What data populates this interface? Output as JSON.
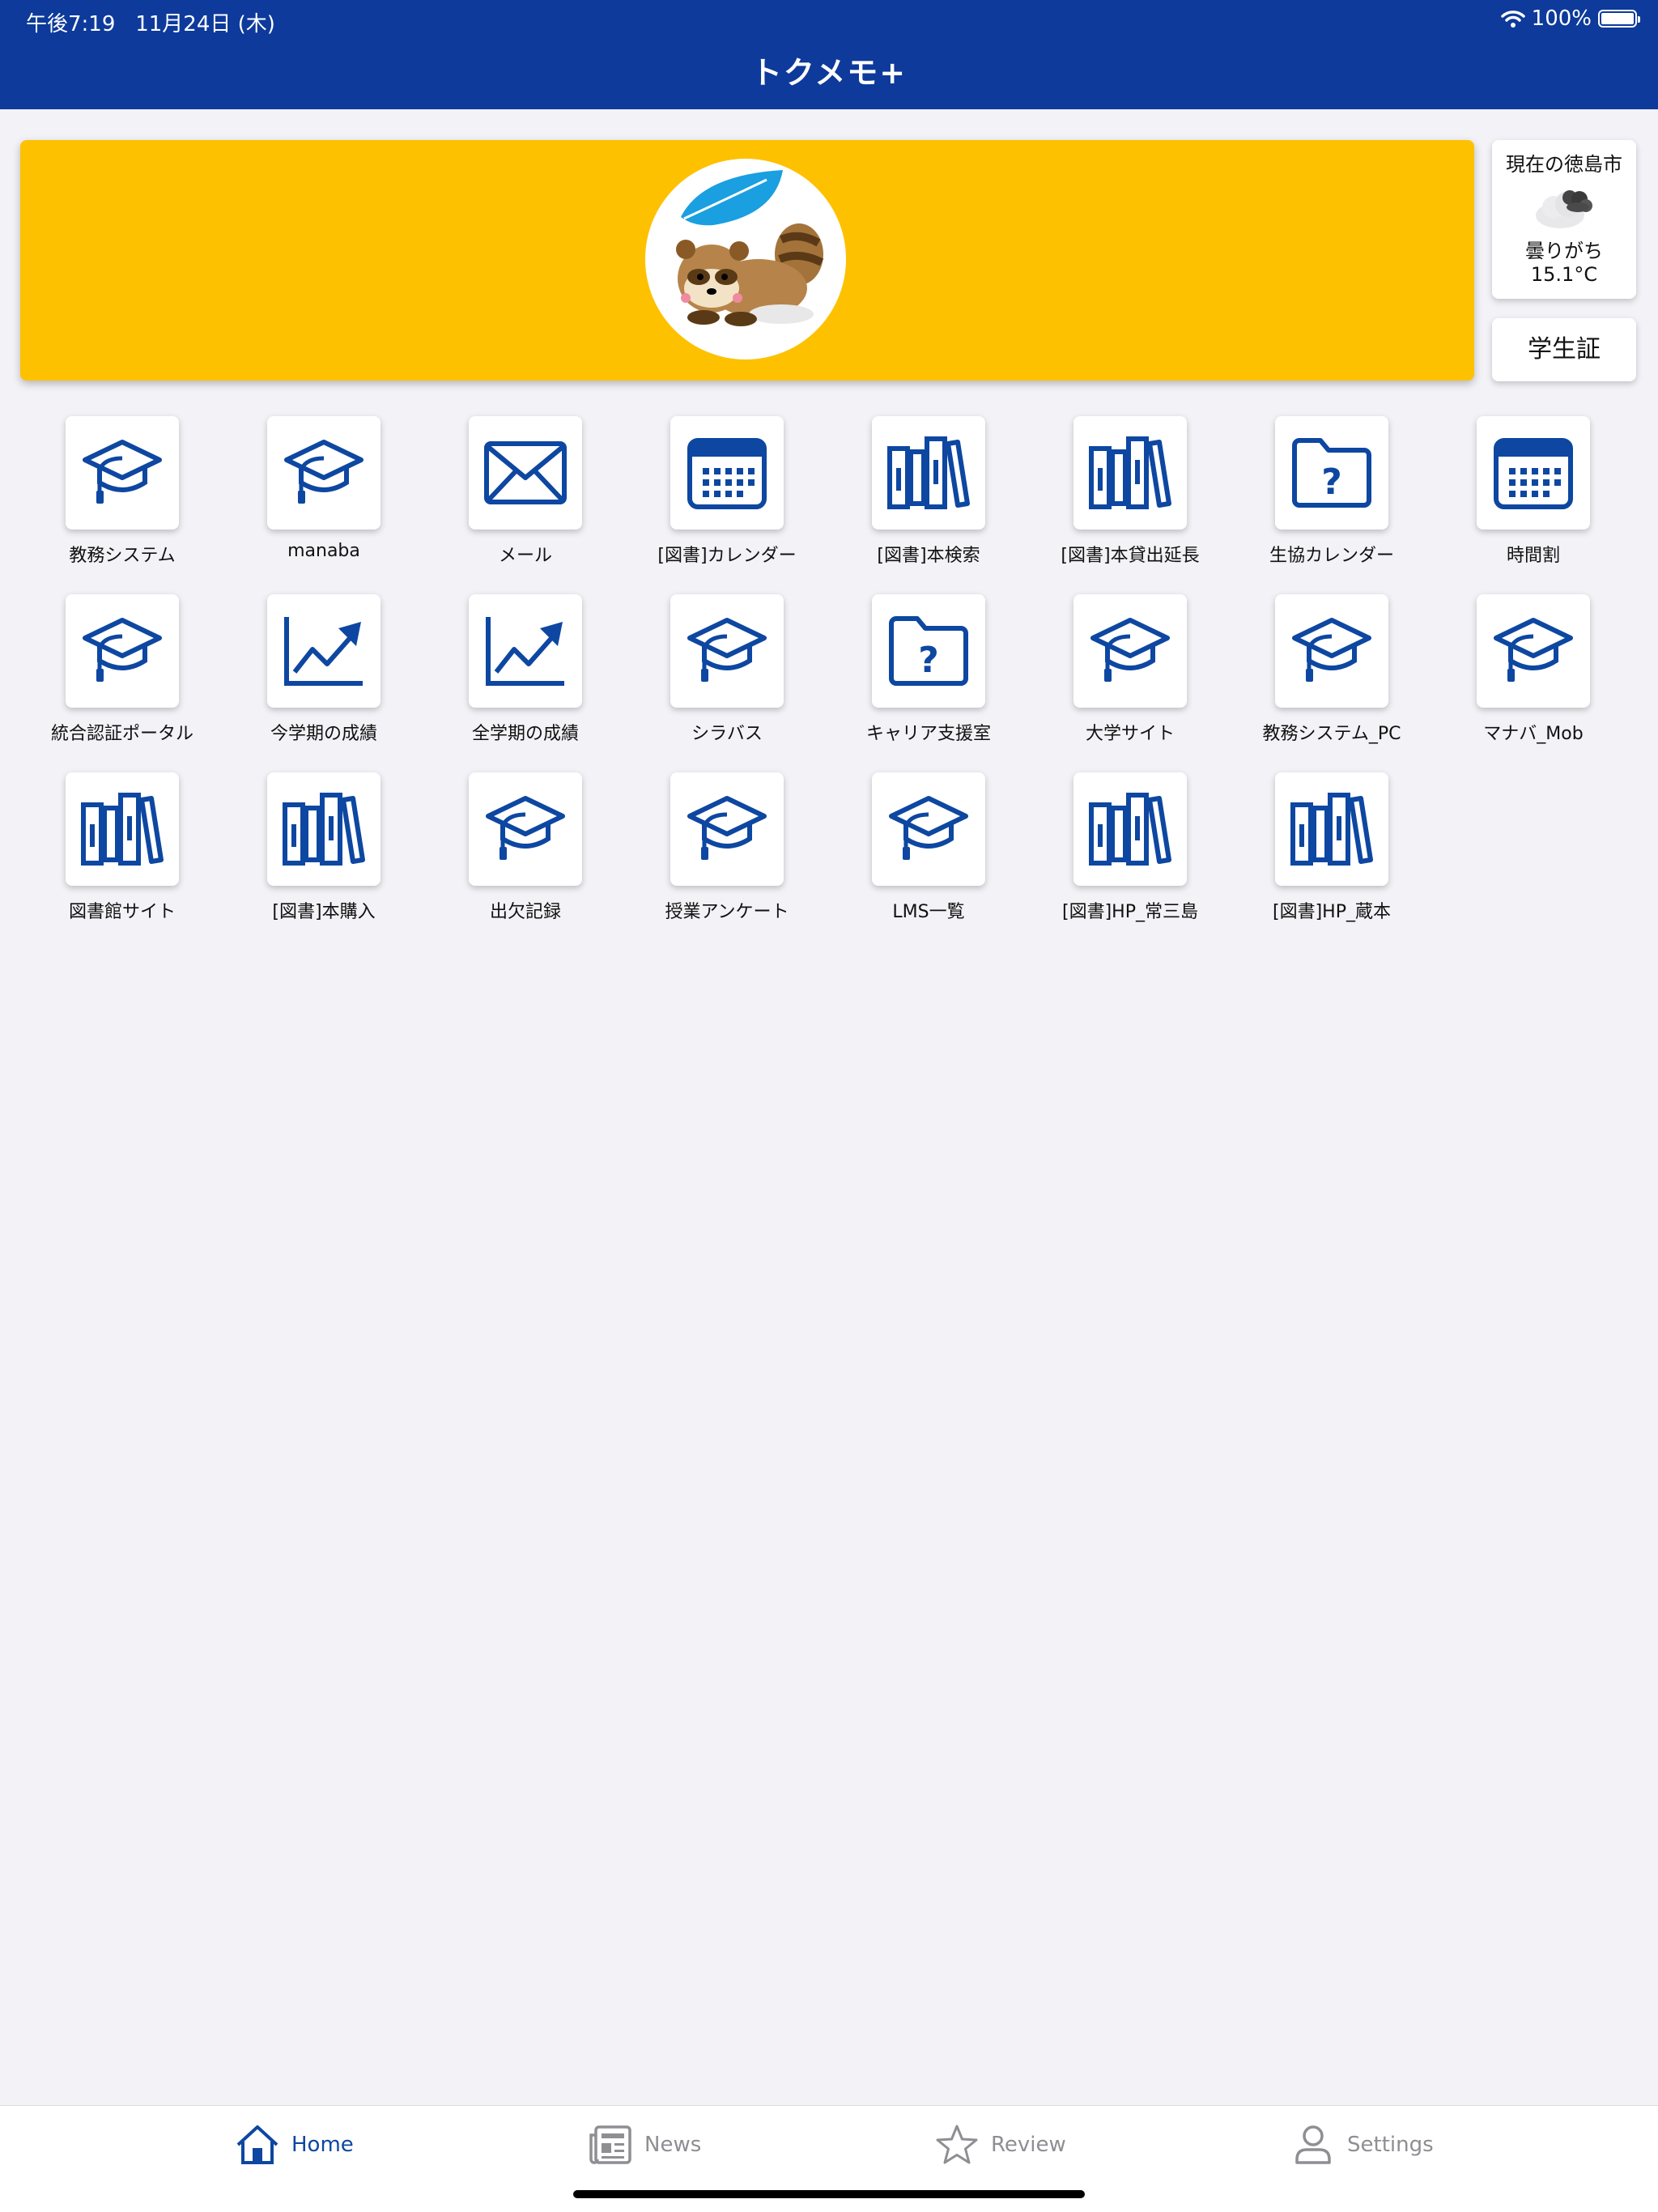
{
  "status_bar": {
    "time": "午後7:19",
    "date": "11月24日 (木)",
    "battery": "100%"
  },
  "nav": {
    "title": "トクメモ+"
  },
  "weather": {
    "city": "現在の徳島市",
    "condition": "曇りがち",
    "temperature": "15.1°C",
    "icon": "cloud-icon"
  },
  "student_id": {
    "label": "学生証"
  },
  "apps": [
    {
      "label": "教務システム",
      "icon": "graduation-cap-icon"
    },
    {
      "label": "manaba",
      "icon": "graduation-cap-icon"
    },
    {
      "label": "メール",
      "icon": "mail-icon"
    },
    {
      "label": "[図書]カレンダー",
      "icon": "calendar-icon"
    },
    {
      "label": "[図書]本検索",
      "icon": "books-icon"
    },
    {
      "label": "[図書]本貸出延長",
      "icon": "books-icon"
    },
    {
      "label": "生協カレンダー",
      "icon": "help-folder-icon"
    },
    {
      "label": "時間割",
      "icon": "calendar-icon"
    },
    {
      "label": "統合認証ポータル",
      "icon": "graduation-cap-icon"
    },
    {
      "label": "今学期の成績",
      "icon": "trend-chart-icon"
    },
    {
      "label": "全学期の成績",
      "icon": "trend-chart-icon"
    },
    {
      "label": "シラバス",
      "icon": "graduation-cap-icon"
    },
    {
      "label": "キャリア支援室",
      "icon": "help-folder-icon"
    },
    {
      "label": "大学サイト",
      "icon": "graduation-cap-icon"
    },
    {
      "label": "教務システム_PC",
      "icon": "graduation-cap-icon"
    },
    {
      "label": "マナバ_Mob",
      "icon": "graduation-cap-icon"
    },
    {
      "label": "図書館サイト",
      "icon": "books-icon"
    },
    {
      "label": "[図書]本購入",
      "icon": "books-icon"
    },
    {
      "label": "出欠記録",
      "icon": "graduation-cap-icon"
    },
    {
      "label": "授業アンケート",
      "icon": "graduation-cap-icon"
    },
    {
      "label": "LMS一覧",
      "icon": "graduation-cap-icon"
    },
    {
      "label": "[図書]HP_常三島",
      "icon": "books-icon"
    },
    {
      "label": "[図書]HP_蔵本",
      "icon": "books-icon"
    }
  ],
  "tabs": [
    {
      "label": "Home",
      "icon": "home-icon",
      "active": true
    },
    {
      "label": "News",
      "icon": "newspaper-icon",
      "active": false
    },
    {
      "label": "Review",
      "icon": "star-icon",
      "active": false
    },
    {
      "label": "Settings",
      "icon": "person-icon",
      "active": false
    }
  ],
  "colors": {
    "primary": "#0d3a9b",
    "banner": "#fec100",
    "icon": "#0d47a1",
    "background": "#f2f2f7"
  }
}
